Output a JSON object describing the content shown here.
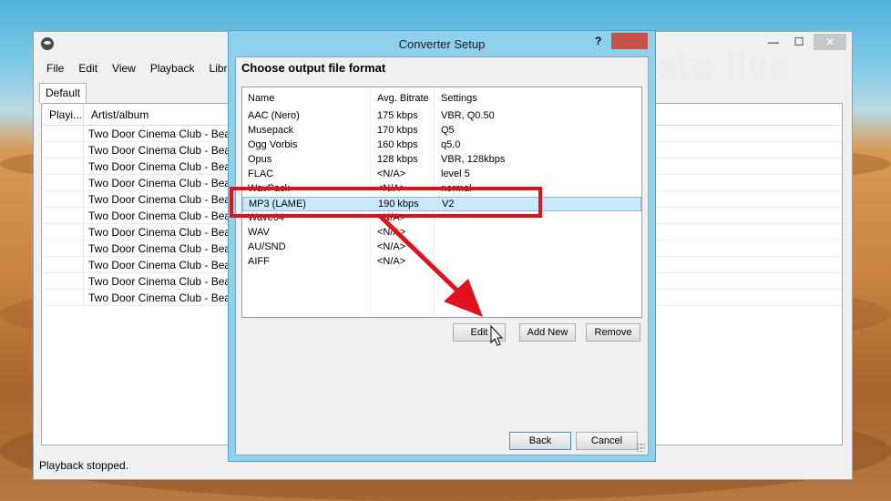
{
  "main_window": {
    "menu": [
      "File",
      "Edit",
      "View",
      "Playback",
      "Librar"
    ],
    "tab": "Default",
    "columns": [
      "Playi...",
      "Artist/album"
    ],
    "rows": [
      "Two Door Cinema Club - Beaco",
      "Two Door Cinema Club - Beaco",
      "Two Door Cinema Club - Beaco",
      "Two Door Cinema Club - Beaco",
      "Two Door Cinema Club - Beaco",
      "Two Door Cinema Club - Beaco",
      "Two Door Cinema Club - Beaco",
      "Two Door Cinema Club - Beaco",
      "Two Door Cinema Club - Beaco",
      "Two Door Cinema Club - Beaco",
      "Two Door Cinema Club - Beaco"
    ],
    "status": "Playback stopped.",
    "controls": {
      "minimize": "—",
      "maximize": "☐",
      "close": "✕"
    }
  },
  "watermark": "pete live",
  "dialog": {
    "title": "Converter Setup",
    "help": "?",
    "heading": "Choose output file format",
    "columns": {
      "name": "Name",
      "bitrate": "Avg. Bitrate",
      "settings": "Settings"
    },
    "formats": [
      {
        "name": "AAC (Nero)",
        "bitrate": "175 kbps",
        "settings": "VBR, Q0.50"
      },
      {
        "name": "Musepack",
        "bitrate": "170 kbps",
        "settings": "Q5"
      },
      {
        "name": "Ogg Vorbis",
        "bitrate": "160 kbps",
        "settings": "q5.0"
      },
      {
        "name": "Opus",
        "bitrate": "128 kbps",
        "settings": "VBR, 128kbps"
      },
      {
        "name": "FLAC",
        "bitrate": "<N/A>",
        "settings": "level 5"
      },
      {
        "name": "WavPack",
        "bitrate": "<N/A>",
        "settings": "normal"
      },
      {
        "name": "MP3 (LAME)",
        "bitrate": "190 kbps",
        "settings": "V2"
      },
      {
        "name": "Wave64",
        "bitrate": "<N/A>",
        "settings": ""
      },
      {
        "name": "WAV",
        "bitrate": "<N/A>",
        "settings": ""
      },
      {
        "name": "AU/SND",
        "bitrate": "<N/A>",
        "settings": ""
      },
      {
        "name": "AIFF",
        "bitrate": "<N/A>",
        "settings": ""
      }
    ],
    "selected_index": 6,
    "buttons": {
      "edit": "Edit",
      "add_new": "Add New",
      "remove": "Remove",
      "back": "Back",
      "cancel": "Cancel"
    }
  },
  "colors": {
    "highlight": "#e0111b",
    "selection": "#cce8ff",
    "dialog_frame": "#8fd0ec"
  }
}
